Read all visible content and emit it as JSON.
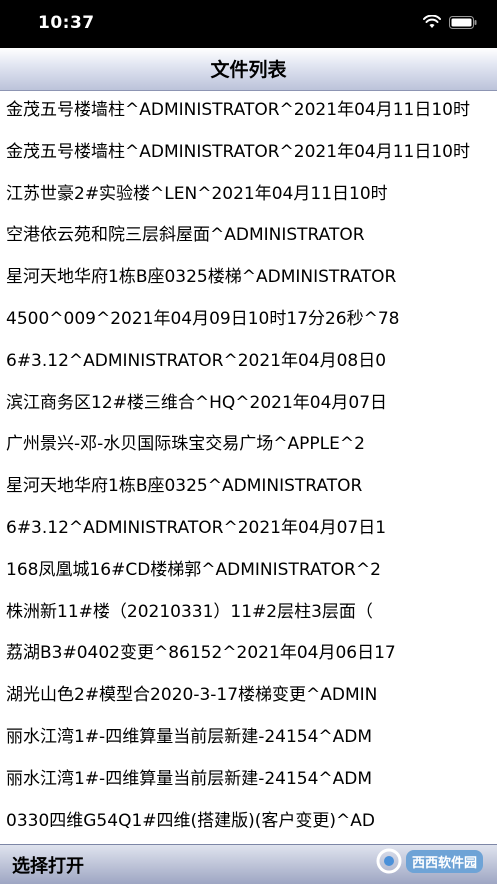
{
  "status_bar": {
    "time": "10:37"
  },
  "nav": {
    "title": "文件列表"
  },
  "files": [
    "金茂五号楼墙柱^ADMINISTRATOR^2021年04月11日10时",
    "金茂五号楼墙柱^ADMINISTRATOR^2021年04月11日10时",
    "江苏世豪2#实验楼^LEN^2021年04月11日10时",
    "空港依云苑和院三层斜屋面^ADMINISTRATOR",
    "星河天地华府1栋B座0325楼梯^ADMINISTRATOR",
    "4500^009^2021年04月09日10时17分26秒^78",
    "6#3.12^ADMINISTRATOR^2021年04月08日0",
    "滨江商务区12#楼三维合^HQ^2021年04月07日",
    "广州景兴-邓-水贝国际珠宝交易广场^APPLE^2",
    "星河天地华府1栋B座0325^ADMINISTRATOR",
    "6#3.12^ADMINISTRATOR^2021年04月07日1",
    "168凤凰城16#CD楼梯郭^ADMINISTRATOR^2",
    "株洲新11#楼（20210331）11#2层柱3层面（",
    "荔湖B3#0402变更^86152^2021年04月06日17",
    "湖光山色2#模型合2020-3-17楼梯变更^ADMIN",
    "丽水江湾1#-四维算量当前层新建-24154^ADM",
    "丽水江湾1#-四维算量当前层新建-24154^ADM",
    "0330四维G54Q1#四维(搭建版)(客户变更)^AD"
  ],
  "bottom_bar": {
    "open_label": "选择打开",
    "watermark": "西西软件园"
  }
}
